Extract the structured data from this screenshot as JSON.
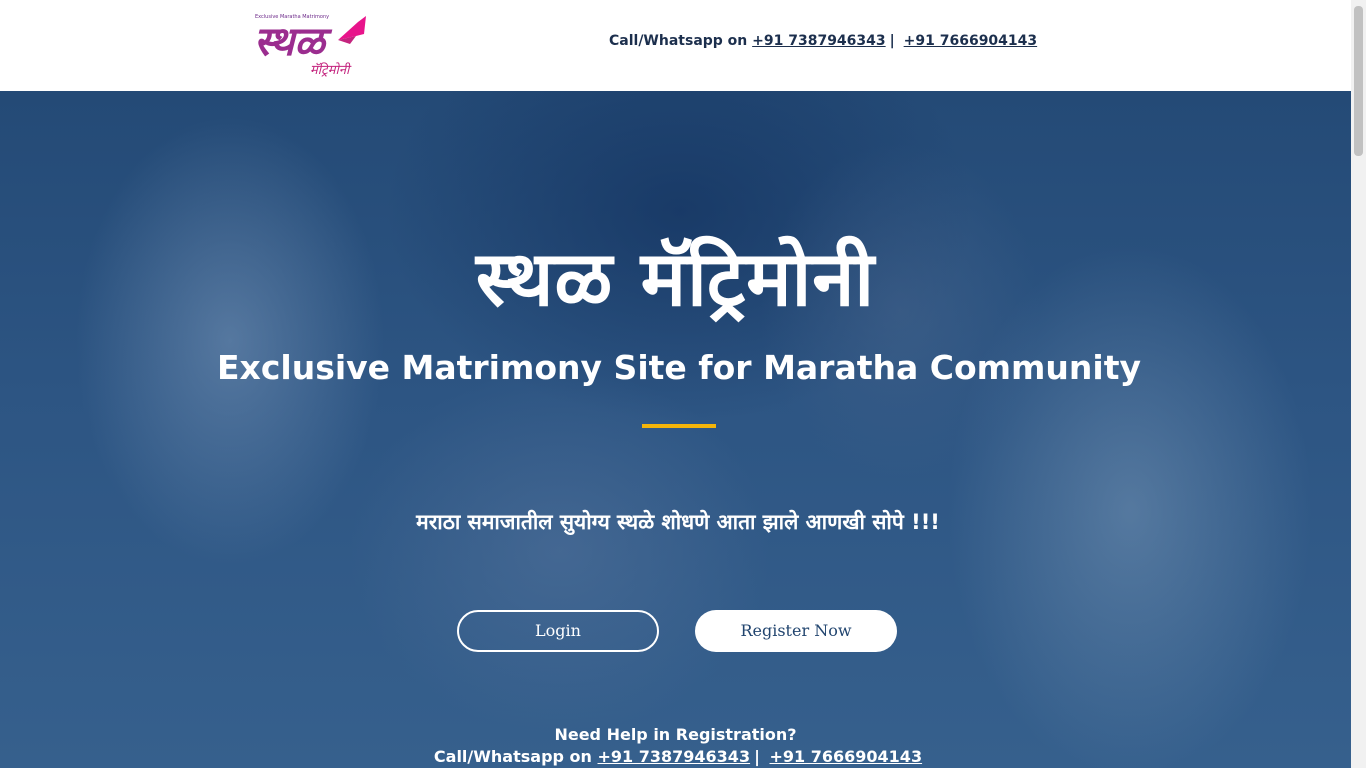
{
  "header": {
    "logo": {
      "tagline": "Exclusive Maratha Matrimony",
      "brand": "स्थळ",
      "sub": "मॅट्रिमोनी",
      "colors": {
        "primary": "#9b2d8f",
        "accent": "#e8148b"
      }
    },
    "contact_prefix": "Call/Whatsapp on",
    "phone1": "+91 7387946343",
    "separator": "|",
    "phone2": "+91 7666904143"
  },
  "hero": {
    "title": "स्थळ मॅट्रिमोनी",
    "subtitle": "Exclusive Matrimony Site for Maratha Community",
    "divider_color": "#f5b50a",
    "tagline": "मराठा समाजातील सुयोग्य स्थळे शोधणे आता झाले आणखी सोपे !!!",
    "login_label": "Login",
    "register_label": "Register Now",
    "help_heading": "Need Help in Registration?",
    "help_prefix": "Call/Whatsapp on",
    "help_phone1": "+91 7387946343",
    "help_separator": "|",
    "help_phone2": "+91 7666904143"
  }
}
